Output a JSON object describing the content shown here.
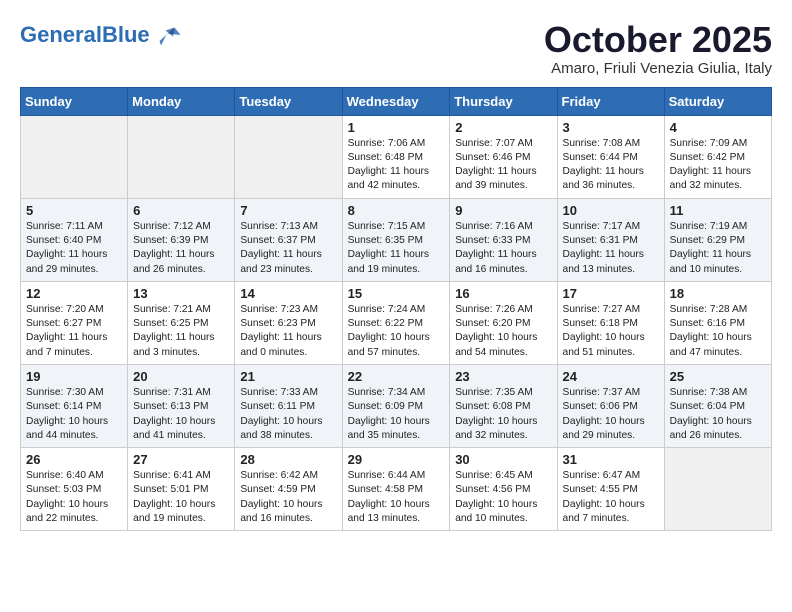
{
  "header": {
    "logo_line1": "General",
    "logo_line2": "Blue",
    "month_title": "October 2025",
    "location": "Amaro, Friuli Venezia Giulia, Italy"
  },
  "days_of_week": [
    "Sunday",
    "Monday",
    "Tuesday",
    "Wednesday",
    "Thursday",
    "Friday",
    "Saturday"
  ],
  "weeks": [
    [
      {
        "num": "",
        "info": ""
      },
      {
        "num": "",
        "info": ""
      },
      {
        "num": "",
        "info": ""
      },
      {
        "num": "1",
        "info": "Sunrise: 7:06 AM\nSunset: 6:48 PM\nDaylight: 11 hours and 42 minutes."
      },
      {
        "num": "2",
        "info": "Sunrise: 7:07 AM\nSunset: 6:46 PM\nDaylight: 11 hours and 39 minutes."
      },
      {
        "num": "3",
        "info": "Sunrise: 7:08 AM\nSunset: 6:44 PM\nDaylight: 11 hours and 36 minutes."
      },
      {
        "num": "4",
        "info": "Sunrise: 7:09 AM\nSunset: 6:42 PM\nDaylight: 11 hours and 32 minutes."
      }
    ],
    [
      {
        "num": "5",
        "info": "Sunrise: 7:11 AM\nSunset: 6:40 PM\nDaylight: 11 hours and 29 minutes."
      },
      {
        "num": "6",
        "info": "Sunrise: 7:12 AM\nSunset: 6:39 PM\nDaylight: 11 hours and 26 minutes."
      },
      {
        "num": "7",
        "info": "Sunrise: 7:13 AM\nSunset: 6:37 PM\nDaylight: 11 hours and 23 minutes."
      },
      {
        "num": "8",
        "info": "Sunrise: 7:15 AM\nSunset: 6:35 PM\nDaylight: 11 hours and 19 minutes."
      },
      {
        "num": "9",
        "info": "Sunrise: 7:16 AM\nSunset: 6:33 PM\nDaylight: 11 hours and 16 minutes."
      },
      {
        "num": "10",
        "info": "Sunrise: 7:17 AM\nSunset: 6:31 PM\nDaylight: 11 hours and 13 minutes."
      },
      {
        "num": "11",
        "info": "Sunrise: 7:19 AM\nSunset: 6:29 PM\nDaylight: 11 hours and 10 minutes."
      }
    ],
    [
      {
        "num": "12",
        "info": "Sunrise: 7:20 AM\nSunset: 6:27 PM\nDaylight: 11 hours and 7 minutes."
      },
      {
        "num": "13",
        "info": "Sunrise: 7:21 AM\nSunset: 6:25 PM\nDaylight: 11 hours and 3 minutes."
      },
      {
        "num": "14",
        "info": "Sunrise: 7:23 AM\nSunset: 6:23 PM\nDaylight: 11 hours and 0 minutes."
      },
      {
        "num": "15",
        "info": "Sunrise: 7:24 AM\nSunset: 6:22 PM\nDaylight: 10 hours and 57 minutes."
      },
      {
        "num": "16",
        "info": "Sunrise: 7:26 AM\nSunset: 6:20 PM\nDaylight: 10 hours and 54 minutes."
      },
      {
        "num": "17",
        "info": "Sunrise: 7:27 AM\nSunset: 6:18 PM\nDaylight: 10 hours and 51 minutes."
      },
      {
        "num": "18",
        "info": "Sunrise: 7:28 AM\nSunset: 6:16 PM\nDaylight: 10 hours and 47 minutes."
      }
    ],
    [
      {
        "num": "19",
        "info": "Sunrise: 7:30 AM\nSunset: 6:14 PM\nDaylight: 10 hours and 44 minutes."
      },
      {
        "num": "20",
        "info": "Sunrise: 7:31 AM\nSunset: 6:13 PM\nDaylight: 10 hours and 41 minutes."
      },
      {
        "num": "21",
        "info": "Sunrise: 7:33 AM\nSunset: 6:11 PM\nDaylight: 10 hours and 38 minutes."
      },
      {
        "num": "22",
        "info": "Sunrise: 7:34 AM\nSunset: 6:09 PM\nDaylight: 10 hours and 35 minutes."
      },
      {
        "num": "23",
        "info": "Sunrise: 7:35 AM\nSunset: 6:08 PM\nDaylight: 10 hours and 32 minutes."
      },
      {
        "num": "24",
        "info": "Sunrise: 7:37 AM\nSunset: 6:06 PM\nDaylight: 10 hours and 29 minutes."
      },
      {
        "num": "25",
        "info": "Sunrise: 7:38 AM\nSunset: 6:04 PM\nDaylight: 10 hours and 26 minutes."
      }
    ],
    [
      {
        "num": "26",
        "info": "Sunrise: 6:40 AM\nSunset: 5:03 PM\nDaylight: 10 hours and 22 minutes."
      },
      {
        "num": "27",
        "info": "Sunrise: 6:41 AM\nSunset: 5:01 PM\nDaylight: 10 hours and 19 minutes."
      },
      {
        "num": "28",
        "info": "Sunrise: 6:42 AM\nSunset: 4:59 PM\nDaylight: 10 hours and 16 minutes."
      },
      {
        "num": "29",
        "info": "Sunrise: 6:44 AM\nSunset: 4:58 PM\nDaylight: 10 hours and 13 minutes."
      },
      {
        "num": "30",
        "info": "Sunrise: 6:45 AM\nSunset: 4:56 PM\nDaylight: 10 hours and 10 minutes."
      },
      {
        "num": "31",
        "info": "Sunrise: 6:47 AM\nSunset: 4:55 PM\nDaylight: 10 hours and 7 minutes."
      },
      {
        "num": "",
        "info": ""
      }
    ]
  ]
}
